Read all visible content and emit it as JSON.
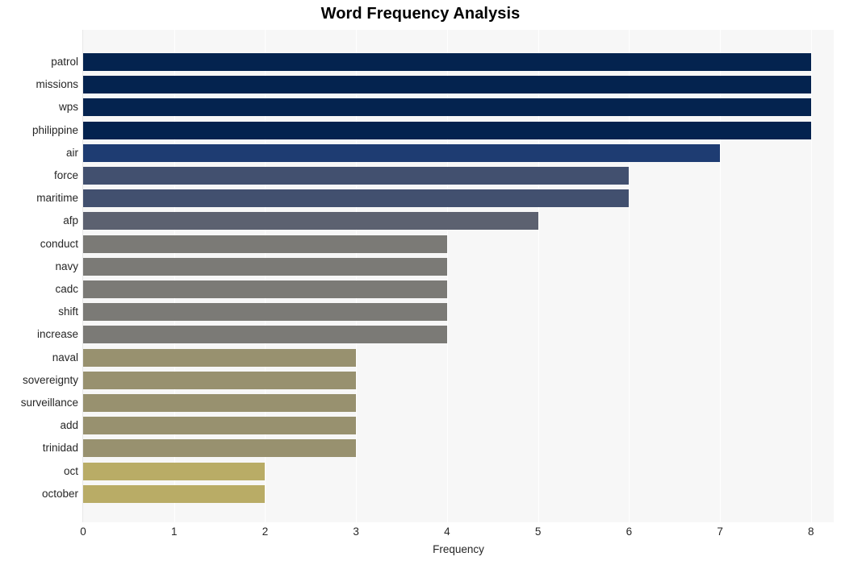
{
  "chart_data": {
    "type": "bar",
    "orientation": "horizontal",
    "title": "Word Frequency Analysis",
    "xlabel": "Frequency",
    "ylabel": "",
    "xlim": [
      0,
      8.25
    ],
    "xticks": [
      0,
      1,
      2,
      3,
      4,
      5,
      6,
      7,
      8
    ],
    "xtick_labels": [
      "0",
      "1",
      "2",
      "3",
      "4",
      "5",
      "6",
      "7",
      "8"
    ],
    "grid": "vertical-white",
    "legend": "none",
    "plot_background": "#f7f7f7",
    "figure_background": "#ffffff",
    "categories": [
      "patrol",
      "missions",
      "wps",
      "philippine",
      "air",
      "force",
      "maritime",
      "afp",
      "conduct",
      "navy",
      "cadc",
      "shift",
      "increase",
      "naval",
      "sovereignty",
      "surveillance",
      "add",
      "trinidad",
      "oct",
      "october"
    ],
    "values": [
      8,
      8,
      8,
      8,
      7,
      6,
      6,
      5,
      4,
      4,
      4,
      4,
      4,
      3,
      3,
      3,
      3,
      3,
      2,
      2
    ],
    "bar_colors": [
      "#04234f",
      "#04234f",
      "#04234f",
      "#04234f",
      "#1e3c72",
      "#42506f",
      "#42506f",
      "#5c6170",
      "#7b7a76",
      "#7b7a76",
      "#7b7a76",
      "#7b7a76",
      "#7b7a76",
      "#98916f",
      "#98916f",
      "#98916f",
      "#98916f",
      "#98916f",
      "#b9ac66",
      "#b9ac66"
    ]
  }
}
